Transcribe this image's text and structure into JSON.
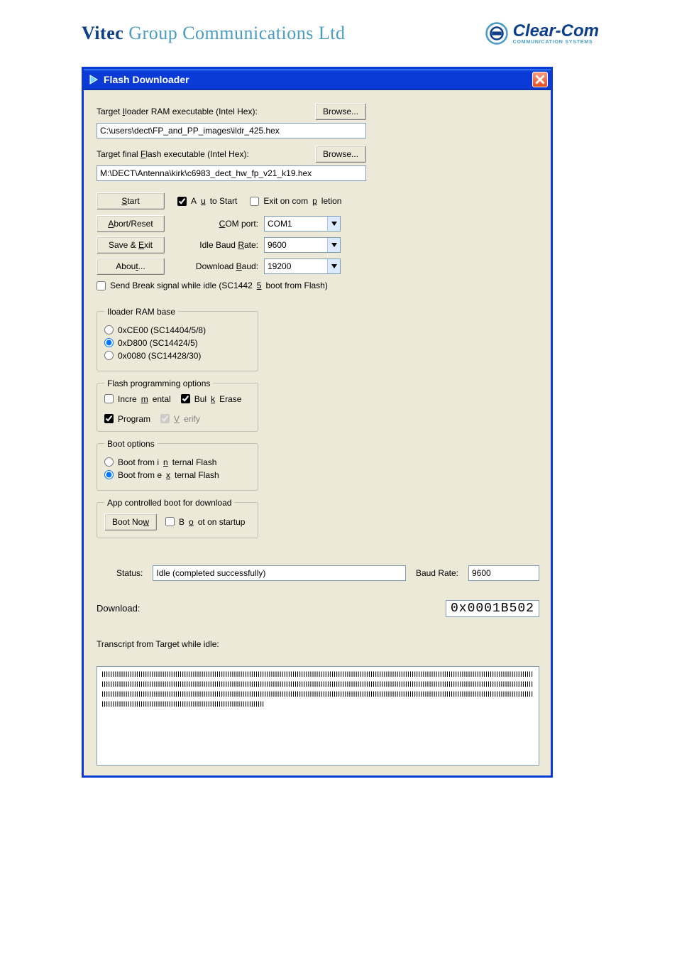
{
  "header": {
    "brand_bold": "Vitec",
    "brand_rest": " Group Communications Ltd",
    "clearcom_brand": "Clear-Com",
    "clearcom_sub": "COMMUNICATION SYSTEMS"
  },
  "window": {
    "title": "Flash Downloader"
  },
  "left": {
    "iloader_label": "Target Iloader RAM executable (Intel Hex):",
    "iloader_path": "C:\\users\\dect\\FP_and_PP_images\\ildr_425.hex",
    "flash_label": "Target final Flash executable (Intel Hex):",
    "flash_path": "M:\\DECT\\Antenna\\kirk\\c6983_dect_hw_fp_v21_k19.hex",
    "browse1": "Browse...",
    "browse2": "Browse...",
    "start": "Start",
    "auto_start": "Auto Start",
    "exit_on_completion": "Exit on completion",
    "abort_reset": "Abort/Reset",
    "com_port_label": "COM port:",
    "com_port_value": "COM1",
    "save_exit": "Save & Exit",
    "idle_baud_label": "Idle Baud Rate:",
    "idle_baud_value": "9600",
    "about": "About...",
    "download_baud_label": "Download Baud:",
    "download_baud_value": "19200",
    "send_break": "Send Break signal while idle (SC14425 boot from Flash)"
  },
  "right": {
    "rambase_legend": "Iloader RAM base",
    "rambase_opts": [
      "0xCE00 (SC14404/5/8)",
      "0xD800 (SC14424/5)",
      "0x0080 (SC14428/30)"
    ],
    "rambase_selected": 1,
    "flashprog_legend": "Flash programming options",
    "incremental": "Incremental",
    "bulk_erase": "Bulk Erase",
    "program": "Program",
    "verify": "Verify",
    "boot_legend": "Boot options",
    "boot_internal": "Boot from internal Flash",
    "boot_external": "Boot from external Flash",
    "boot_selected": 1,
    "appboot_legend": "App controlled boot for download",
    "boot_now": "Boot Now",
    "boot_on_startup": "Boot on startup"
  },
  "status": {
    "status_label": "Status:",
    "status_value": "Idle (completed successfully)",
    "baud_label": "Baud Rate:",
    "baud_value": "9600",
    "download_label": "Download:",
    "download_value": "0x0001B502",
    "transcript_label": "Transcript from Target while idle:",
    "transcript_text": "IIIIIIIIIIIIIIIIIIIIIIIIIIIIIIIIIIIIIIIIIIIIIIIIIIIIIIIIIIIIIIIIIIIIIIIIIIIIIIIIIIIIIIIIIIIIIIIIIIIIIIIIIIIIIIIIIIIIIIIIIIIIIIIIIIIIIIIIIIIIIIIIIIIIIIIIIIIIIIIIIIIIIIIIIIIIIIIIIIIIIIIIIIIIIIIIIIIIIIIIIIIIIIIIIIIIIIIIIIIIIIIIIIIIIIIIIIIIIIIIIIIIIIIIIIIIIIIIIIIIIIIIIIIIIIIIIIIIIIIIIIIIIIIIIIIIIIIIIIIIIIIIIIIIIIIIIIIIIIIIIIIIIIIIIIIIIIIIIIIIIIIIIIIIIIIIIIIIIIIIIIIIIIIIIIIIIIIIIIIIIIIIIIIIIIIIIIIIIIIIIIIIIIIIIIIIIIIIIIIIIIIIIIIIIIIIIIIIIIIIIIIIIIIIIIIIIIIIIIIIIIIIIIIIIIIIIIIIIIIIIIIIIIIIIIIIIIIIIIIIIIIIIIIIIIIIIIIIIIIIIIIIIIIIIIIIIIIIIIIIIIIIIIIIIIIIIIIIIIIIIIIIIIIIIIIIIIIIIIIIIIIIIIIIIIIIIIIIIIIIIIIIIIIIIIIIIIIIIIIIIIIIIIIIIIIIIIIIIIIIIIIIIIIIIIIIIIIIIIIIIIIIIIIIIIII"
  }
}
